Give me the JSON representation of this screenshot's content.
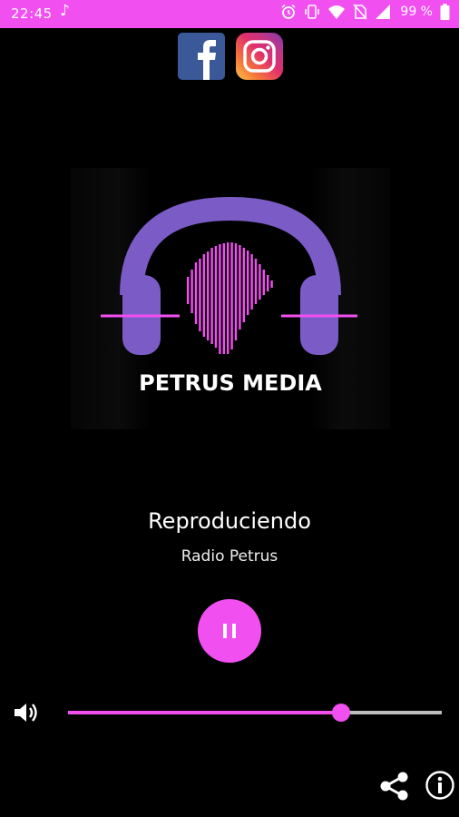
{
  "status_bar": {
    "time": "22:45",
    "battery_text": "99 %",
    "icons": [
      "music-note-icon",
      "alarm-icon",
      "vibrate-icon",
      "wifi-icon",
      "no-sim-icon",
      "signal-icon",
      "battery-icon"
    ],
    "color": "#f24ff0"
  },
  "social": {
    "facebook": {
      "icon": "facebook-icon",
      "letter": "f"
    },
    "instagram": {
      "icon": "instagram-icon"
    }
  },
  "cover": {
    "logo_text": "PETRUS MEDIA",
    "accent_color": "#f24ff0",
    "headphone_color": "#7b5cc7"
  },
  "player": {
    "status": "Reproduciendo",
    "station": "Radio Petrus",
    "button_icon": "pause-icon"
  },
  "volume": {
    "icon": "volume-icon",
    "level": 0.73
  },
  "footer": {
    "share_icon": "share-icon",
    "info_icon": "info-icon"
  }
}
